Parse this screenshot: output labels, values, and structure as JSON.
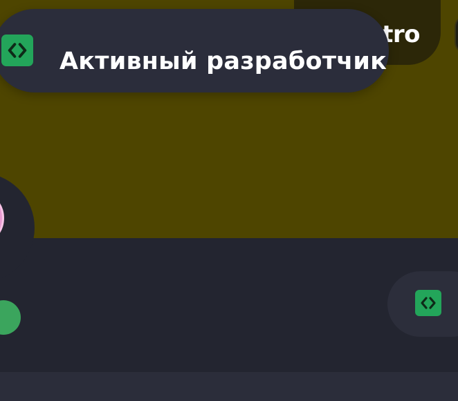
{
  "banner": {
    "color": "#4e4500"
  },
  "nitro": {
    "label_visible_fragment": "tro"
  },
  "tooltip": {
    "label": "Активный разработчик",
    "icon": "active-developer-icon"
  },
  "profile": {
    "avatar_color": "#e79ad0",
    "status": "online",
    "status_color": "#3ba55d"
  },
  "badges": [
    {
      "icon": "active-developer-icon",
      "color": "#23a55a"
    }
  ]
}
